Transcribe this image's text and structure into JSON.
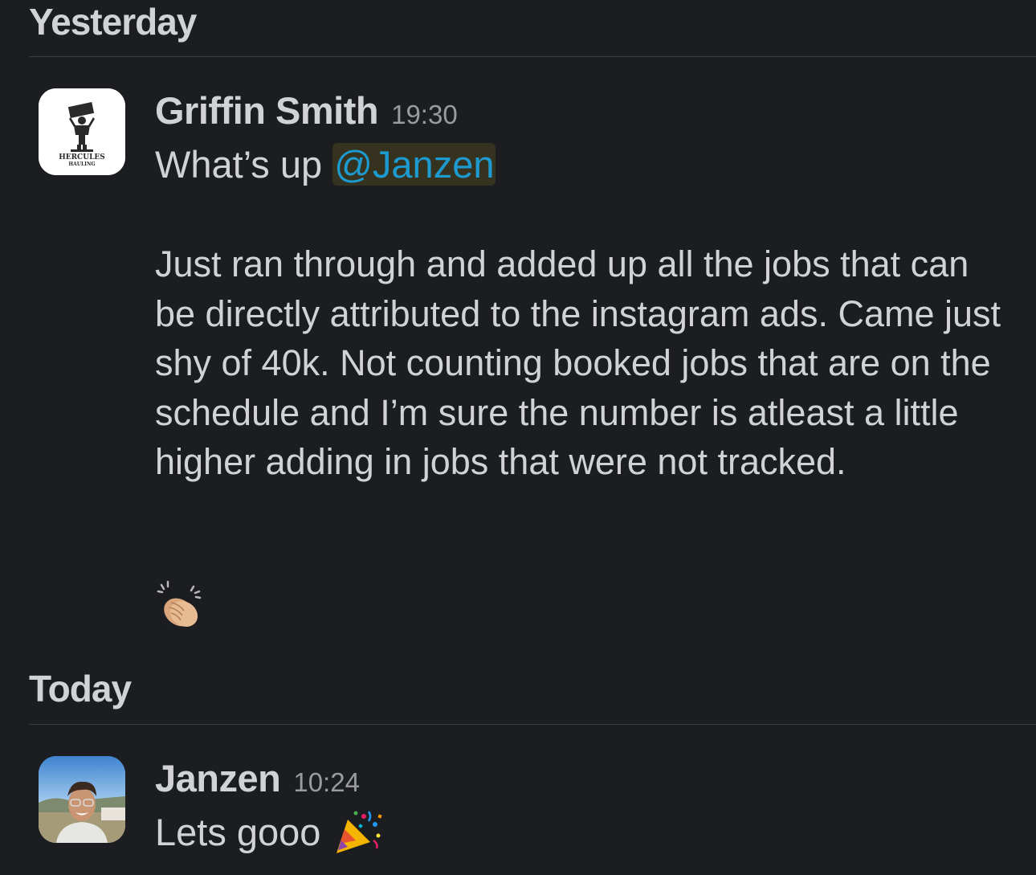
{
  "days": {
    "yesterday": "Yesterday",
    "today": "Today"
  },
  "messages": [
    {
      "sender": "Griffin Smith",
      "time": "19:30",
      "greeting": "What’s up",
      "mention": "@Janzen",
      "body": "Just ran through and added up all the jobs that can be directly attributed to the instagram ads. Came just shy of 40k. Not counting booked jobs that are on the schedule and I’m sure the number is atleast a little higher adding in jobs that were not tracked.",
      "emoji": "clapping-hands-emoji",
      "avatar_text": [
        "HERCULES",
        "HAULING"
      ]
    },
    {
      "sender": "Janzen",
      "time": "10:24",
      "text": "Lets gooo",
      "emoji": "party-popper-emoji"
    }
  ],
  "colors": {
    "background": "#1b1d21",
    "text": "#d1d2d3",
    "timestamp": "#9a9b9e",
    "mention": "#1d9bd1",
    "mention_bg": "#35331f",
    "divider": "#3a3c40"
  }
}
